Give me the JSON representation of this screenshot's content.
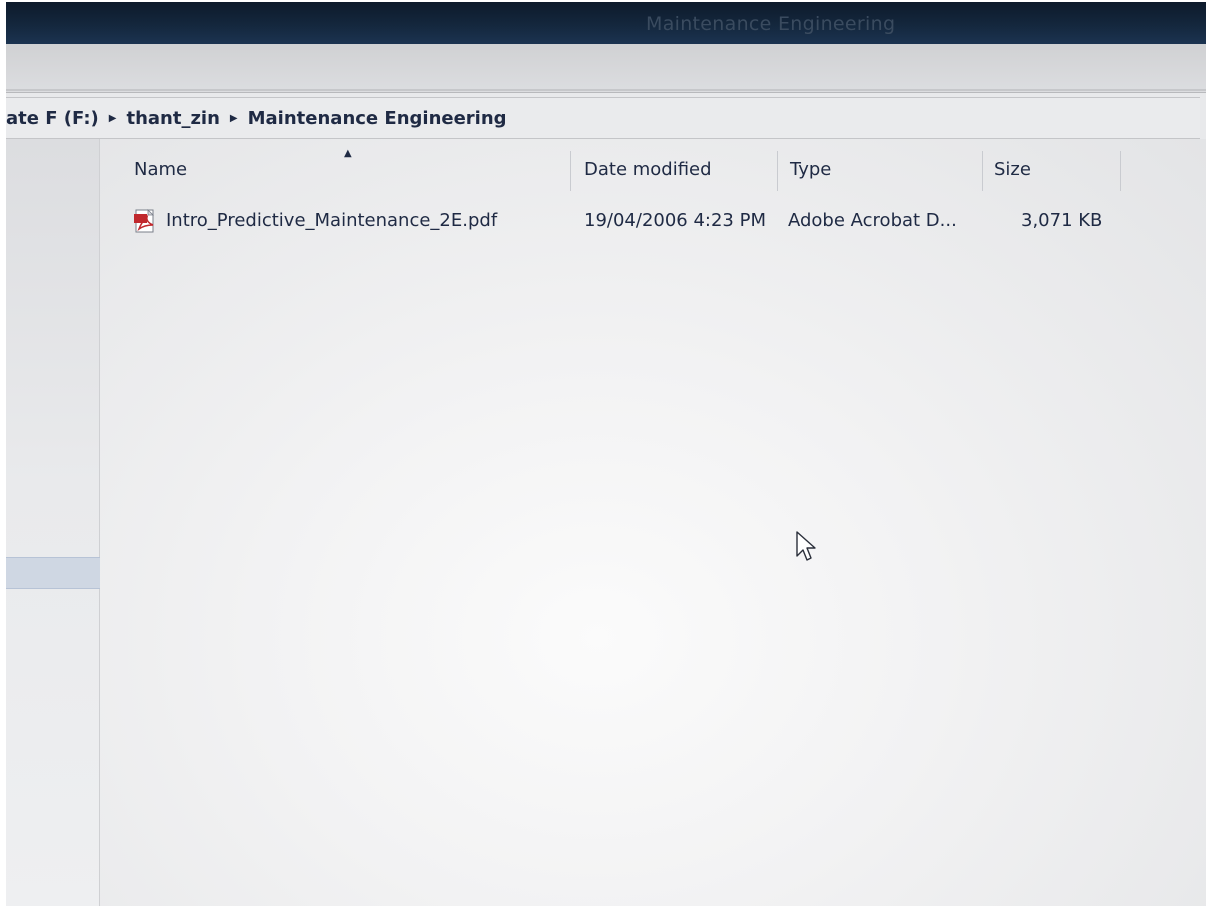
{
  "window": {
    "title": "Maintenance Engineering"
  },
  "address_bar": {
    "crumbs": [
      "ate F (F:)",
      "thant_zin",
      "Maintenance Engineering"
    ],
    "separator_icon": "chevron-right-icon"
  },
  "columns": {
    "name": "Name",
    "date_modified": "Date modified",
    "type": "Type",
    "size": "Size",
    "sort_icon": "sort-ascending-icon"
  },
  "files": [
    {
      "icon": "pdf-file-icon",
      "name": "Intro_Predictive_Maintenance_2E.pdf",
      "date_modified": "19/04/2006 4:23 PM",
      "type": "Adobe Acrobat D...",
      "size": "3,071 KB"
    }
  ],
  "colors": {
    "titlebar": "#14273d",
    "text": "#1f2a44",
    "pdf_red": "#c0282d"
  }
}
